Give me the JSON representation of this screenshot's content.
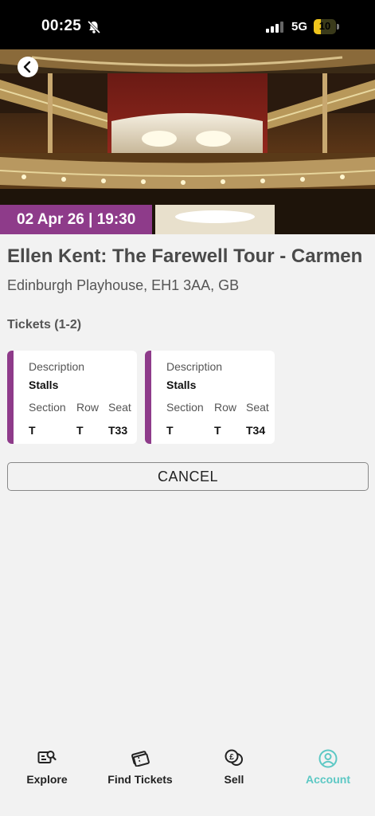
{
  "status_bar": {
    "time": "00:25",
    "network": "5G",
    "battery": "10",
    "battery_level_pct": 10,
    "icons": [
      "bell-off-icon",
      "signal-icon",
      "battery-icon"
    ]
  },
  "event": {
    "date_time": "02 Apr 26 | 19:30",
    "title": "Ellen Kent: The Farewell Tour - Carmen",
    "venue": "Edinburgh Playhouse, EH1 3AA, GB"
  },
  "tickets": {
    "heading": "Tickets (1-2)",
    "labels": {
      "description": "Description",
      "section": "Section",
      "row": "Row",
      "seat": "Seat"
    },
    "items": [
      {
        "description": "Stalls",
        "section": "T",
        "row": "T",
        "seat": "T33"
      },
      {
        "description": "Stalls",
        "section": "T",
        "row": "T",
        "seat": "T34"
      }
    ]
  },
  "actions": {
    "cancel_label": "CANCEL"
  },
  "nav": {
    "items": [
      {
        "label": "Explore",
        "icon": "explore-icon"
      },
      {
        "label": "Find Tickets",
        "icon": "tickets-icon"
      },
      {
        "label": "Sell",
        "icon": "sell-icon"
      },
      {
        "label": "Account",
        "icon": "account-icon",
        "active": true
      }
    ]
  },
  "colors": {
    "accent": "#8e3b8a",
    "active_nav": "#5cc8c4"
  }
}
